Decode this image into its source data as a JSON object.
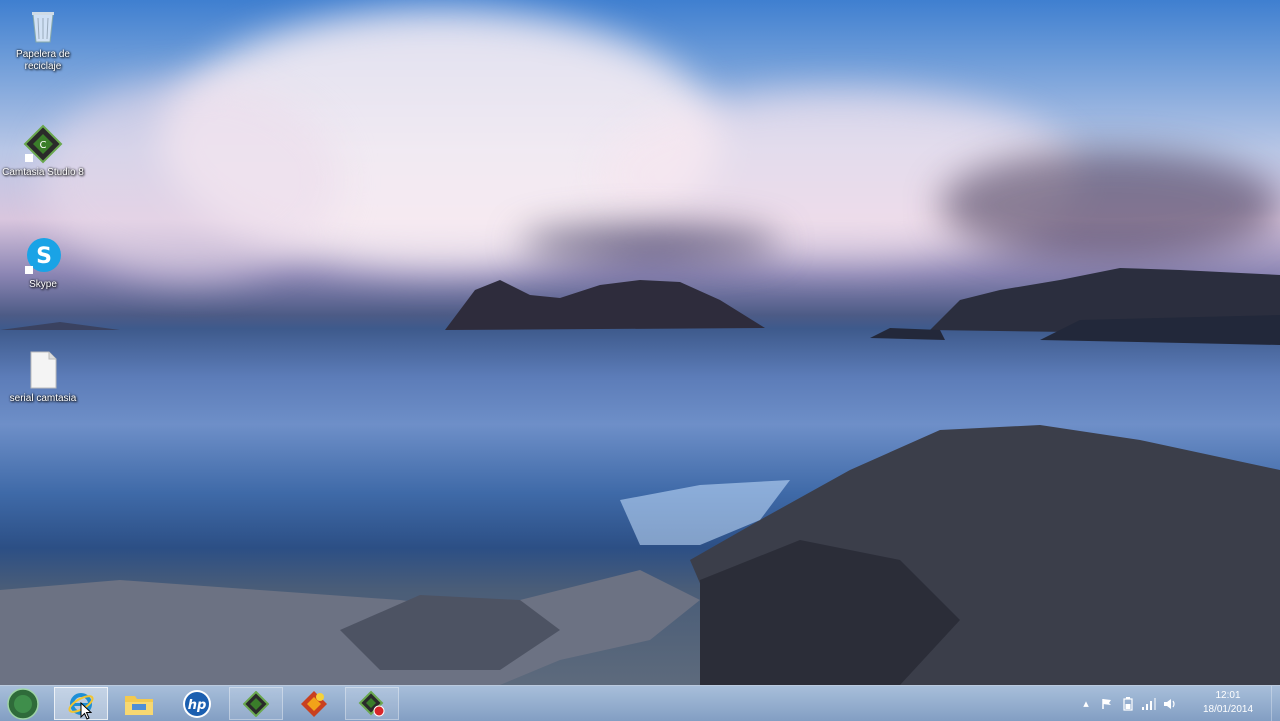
{
  "desktop": {
    "icons": [
      {
        "name": "recycle-bin",
        "label": "Papelera de reciclaje"
      },
      {
        "name": "camtasia-studio",
        "label": "Camtasia Studio 8"
      },
      {
        "name": "skype",
        "label": "Skype"
      },
      {
        "name": "serial-camtasia",
        "label": "serial camtasia"
      }
    ]
  },
  "taskbar": {
    "start_icon": "start-orb-icon",
    "pinned": [
      {
        "name": "internet-explorer",
        "icon": "internet-explorer-icon"
      },
      {
        "name": "file-explorer",
        "icon": "folder-icon"
      },
      {
        "name": "hp",
        "icon": "hp-icon",
        "text": "hp"
      },
      {
        "name": "camtasia-studio",
        "icon": "camtasia-icon"
      },
      {
        "name": "app-red",
        "icon": "camtasia-recorder-icon"
      },
      {
        "name": "camtasia-recorder",
        "icon": "camtasia-rec-icon"
      }
    ],
    "tray": {
      "icons": [
        "show-hidden-icon",
        "flag-icon",
        "battery-icon",
        "signal-icon",
        "volume-icon"
      ],
      "time": "12:01",
      "date": "18/01/2014"
    }
  },
  "colors": {
    "taskbar": "#8fa9cc",
    "skype": "#1aa3e6",
    "camtasia": "#3a7d2a",
    "hp": "#1b5fb0"
  }
}
